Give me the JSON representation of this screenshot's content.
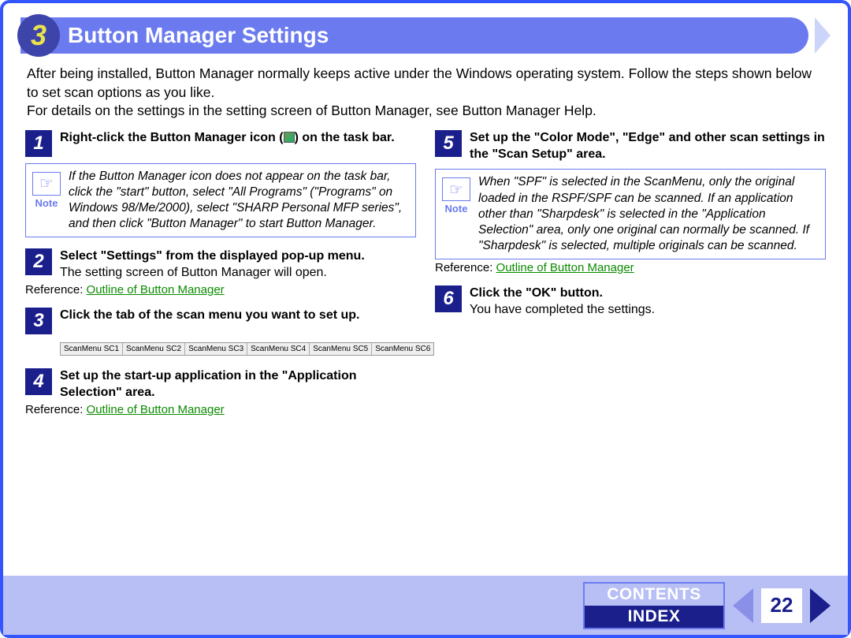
{
  "chapter_number": "3",
  "title": "Button Manager Settings",
  "intro": "After being installed, Button Manager normally keeps active under the Windows operating system. Follow the steps shown below to set scan options as you like.\nFor details on the settings in the setting screen of Button Manager, see Button Manager Help.",
  "reference_label": "Reference:",
  "reference_link": "Outline of Button Manager",
  "note_label": "Note",
  "steps_left": [
    {
      "num": "1",
      "title_pre": "Right-click the Button Manager icon (",
      "title_post": ") on the task bar.",
      "note": "If the Button Manager icon does not appear on the task bar, click the \"start\" button, select \"All Programs\" (\"Programs\" on Windows 98/Me/2000), select \"SHARP Personal MFP series\", and then click \"Button Manager\" to start Button Manager."
    },
    {
      "num": "2",
      "title": "Select \"Settings\" from the displayed pop-up menu.",
      "sub": "The setting screen of Button Manager will open.",
      "has_reference": true
    },
    {
      "num": "3",
      "title": "Click the tab of the scan menu you want to set up.",
      "tabs": [
        "ScanMenu SC1",
        "ScanMenu SC2",
        "ScanMenu SC3",
        "ScanMenu SC4",
        "ScanMenu SC5",
        "ScanMenu SC6"
      ]
    },
    {
      "num": "4",
      "title": "Set up the start-up application in the \"Application Selection\" area.",
      "has_reference": true
    }
  ],
  "steps_right": [
    {
      "num": "5",
      "title": "Set up the \"Color Mode\", \"Edge\" and other scan settings in the \"Scan Setup\" area.",
      "note": "When \"SPF\" is selected in the ScanMenu, only the original loaded in the RSPF/SPF can be scanned. If an application other than \"Sharpdesk\" is selected in the \"Application Selection\" area, only one original can normally be scanned. If \"Sharpdesk\" is selected, multiple originals can be scanned.",
      "has_reference": true
    },
    {
      "num": "6",
      "title": "Click the \"OK\" button.",
      "sub": "You have completed the settings."
    }
  ],
  "footer": {
    "contents": "CONTENTS",
    "index": "INDEX",
    "page": "22"
  }
}
